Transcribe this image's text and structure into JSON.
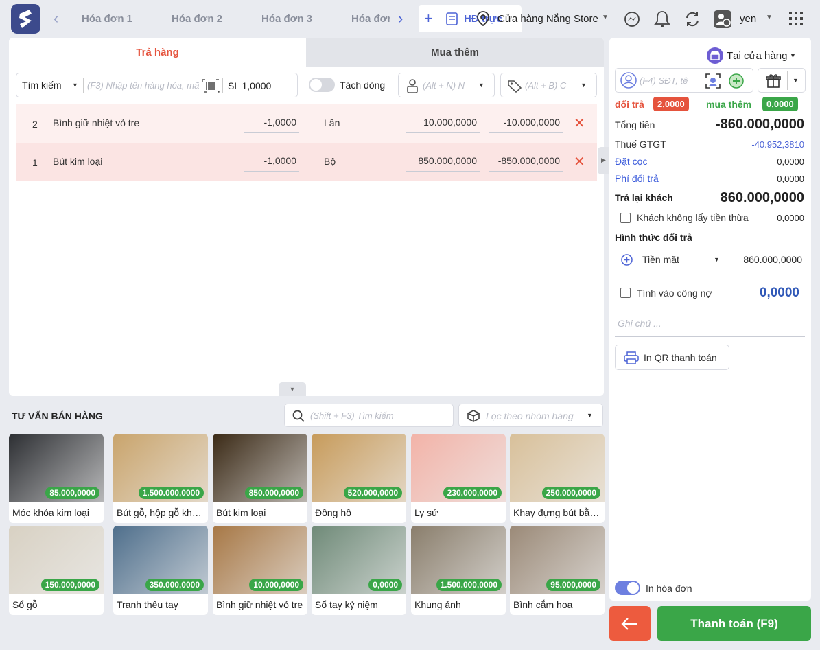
{
  "header": {
    "tabs": [
      "Hóa đơn 1",
      "Hóa đơn 2",
      "Hóa đơn 3",
      "Hóa đơn"
    ],
    "active_tab": "HĐ trực",
    "store": "Cửa hàng Nắng Store",
    "user": "yen"
  },
  "order": {
    "tab_return": "Trả hàng",
    "tab_buy_more": "Mua thêm",
    "search_mode": "Tìm kiếm",
    "search_placeholder": "(F3) Nhập tên hàng hóa, mã",
    "qty": "SL 1,0000",
    "split_label": "Tách dòng",
    "customer_placeholder": "(Alt + N) N",
    "price_placeholder": "(Alt + B) C",
    "items": [
      {
        "no": "2",
        "name": "Bình giữ nhiệt vỏ tre",
        "qty": "-1,0000",
        "unit": "Lần",
        "price": "10.000,0000",
        "total": "-10.000,0000"
      },
      {
        "no": "1",
        "name": "Bút kim loại",
        "qty": "-1,0000",
        "unit": "Bộ",
        "price": "850.000,0000",
        "total": "-850.000,0000"
      }
    ]
  },
  "advice": {
    "title": "TƯ VẤN BÁN HÀNG",
    "search_placeholder": "(Shift + F3) Tìm kiếm",
    "filter_placeholder": "Lọc theo nhóm hàng",
    "products": [
      {
        "name": "Móc khóa kim loại",
        "price": "85.000,0000",
        "color": "#2d2f33"
      },
      {
        "name": "Bút gỗ, hộp gỗ khắc tên",
        "price": "1.500.000,0000",
        "color": "#c9a46c"
      },
      {
        "name": "Bút kim loại",
        "price": "850.000,0000",
        "color": "#3b2a16"
      },
      {
        "name": "Đồng hồ",
        "price": "520.000,0000",
        "color": "#c79b5b"
      },
      {
        "name": "Ly sứ",
        "price": "230.000,0000",
        "color": "#f2b3a8"
      },
      {
        "name": "Khay đựng bút bằng gỗ",
        "price": "250.000,0000",
        "color": "#d8c09a"
      },
      {
        "name": "Sổ gỗ",
        "price": "150.000,0000",
        "color": "#d8d1c3"
      },
      {
        "name": "Tranh thêu tay",
        "price": "350.000,0000",
        "color": "#4f6f8c"
      },
      {
        "name": "Bình giữ nhiệt vỏ tre",
        "price": "10.000,0000",
        "color": "#a77846"
      },
      {
        "name": "Sổ tay kỷ niệm",
        "price": "0,0000",
        "color": "#6f8a78"
      },
      {
        "name": "Khung ảnh",
        "price": "1.500.000,0000",
        "color": "#8a7e6c"
      },
      {
        "name": "Bình cắm hoa",
        "price": "95.000,0000",
        "color": "#9b8a78"
      }
    ]
  },
  "summary": {
    "channel": "Tại cửa hàng",
    "phone_placeholder": "(F4) SĐT, tê",
    "return_label": "đổi trả",
    "return_count": "2,0000",
    "buy_label": "mua thêm",
    "buy_count": "0,0000",
    "total_label": "Tổng tiền",
    "total": "-860.000,0000",
    "vat_label": "Thuế GTGT",
    "vat": "-40.952,3810",
    "deposit_label": "Đặt cọc",
    "deposit": "0,0000",
    "fee_label": "Phí đổi trả",
    "fee": "0,0000",
    "refund_label": "Trả lại khách",
    "refund": "860.000,0000",
    "no_change_label": "Khách không lấy tiền thừa",
    "no_change": "0,0000",
    "method_label": "Hình thức đổi trả",
    "method": "Tiền mặt",
    "method_amount": "860.000,0000",
    "debt_label": "Tính vào công nợ",
    "debt": "0,0000",
    "note_placeholder": "Ghi chú ...",
    "qr_button": "In QR thanh toán",
    "print_label": "In hóa đơn",
    "pay_button": "Thanh toán (F9)"
  }
}
